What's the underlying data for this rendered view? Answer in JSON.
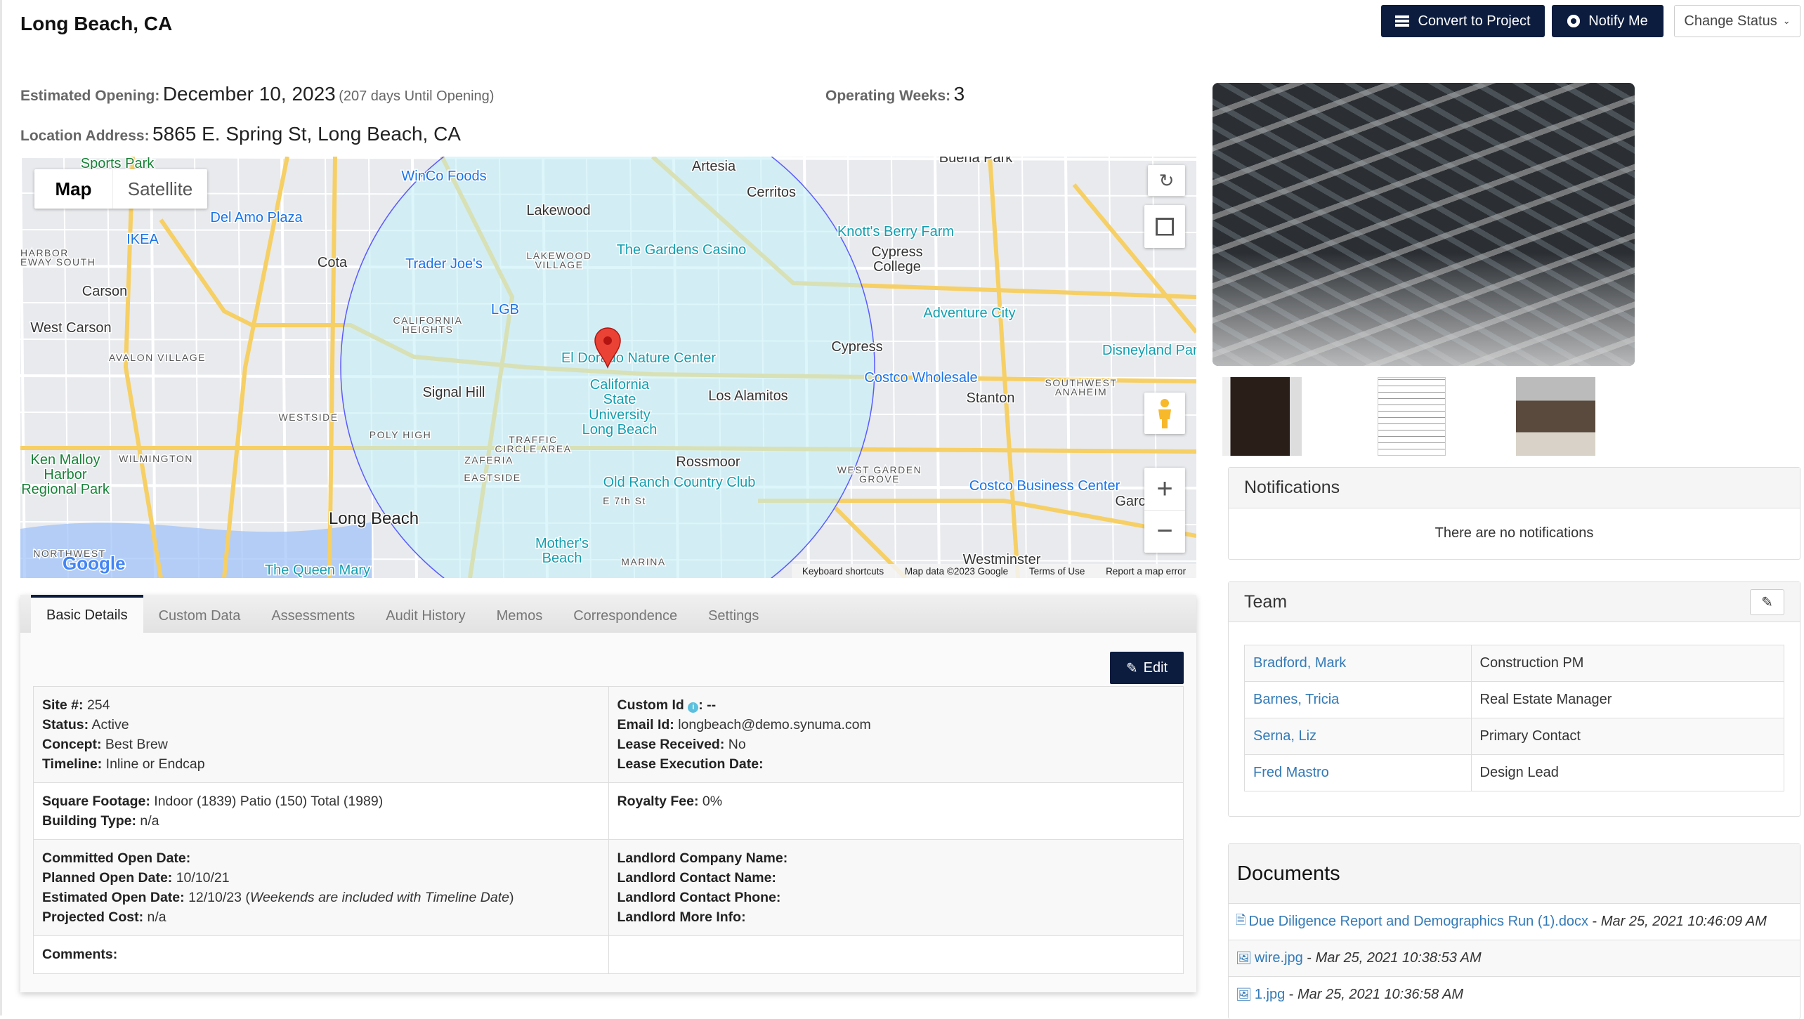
{
  "header": {
    "title": "Long Beach, CA",
    "convert_label": "Convert to Project",
    "notify_label": "Notify Me",
    "change_status_label": "Change Status"
  },
  "summary": {
    "estimated_opening_label": "Estimated Opening:",
    "estimated_opening_value": "December 10, 2023",
    "days_until": "(207 days Until Opening)",
    "operating_weeks_label": "Operating Weeks:",
    "operating_weeks_value": "3",
    "address_label": "Location Address:",
    "address_value": "5865 E. Spring St, Long Beach, CA"
  },
  "map": {
    "type_map": "Map",
    "type_satellite": "Satellite",
    "footer": {
      "shortcuts": "Keyboard shortcuts",
      "data": "Map data ©2023 Google",
      "terms": "Terms of Use",
      "report": "Report a map error"
    },
    "logo": "Google",
    "circle_color": "#5a5aff",
    "pin_color": "#ea4335",
    "labels": {
      "sports_park": "Sports Park",
      "winco": "WinCo Foods",
      "lakewood": "Lakewood",
      "cerritos": "Cerritos",
      "artesia": "Artesia",
      "buena_park": "Buena Park",
      "del_amo": "Del Amo Plaza",
      "ikea": "IKEA",
      "cota": "Cota",
      "trader_joes": "Trader Joe's",
      "gardens_casino": "The Gardens Casino",
      "knotts": "Knott's Berry Farm",
      "cypress_college_1": "Cypress",
      "cypress_college_2": "College",
      "carson": "Carson",
      "lgb": "LGB",
      "adventure_city": "Adventure City",
      "west_carson": "West Carson",
      "cypress": "Cypress",
      "disneyland": "Disneyland Par",
      "el_dorado": "El Dorado Nature Center",
      "costco_wholesale": "Costco Wholesale",
      "signal_hill": "Signal Hill",
      "csulb_1": "California",
      "csulb_2": "State",
      "csulb_3": "University",
      "csulb_4": "Long Beach",
      "los_alamitos": "Los Alamitos",
      "stanton": "Stanton",
      "rossmoor": "Rossmoor",
      "old_ranch": "Old Ranch Country Club",
      "costco_business": "Costco Business Center",
      "ken_malloy_1": "Ken Malloy",
      "ken_malloy_2": "Harbor",
      "ken_malloy_3": "Regional Park",
      "long_beach": "Long Beach",
      "mothers_beach_1": "Mother's",
      "mothers_beach_2": "Beach",
      "westminster": "Westminster",
      "queen_mary": "The Queen Mary",
      "garden_grove": "Garc",
      "e7th": "E 7th St",
      "harbor_1": "HARBOR",
      "harbor_2": "EWAY SOUTH",
      "avalon": "AVALON VILLAGE",
      "cal_heights_1": "CALIFORNIA",
      "cal_heights_2": "HEIGHTS",
      "lakewood_village_1": "LAKEWOOD",
      "lakewood_village_2": "VILLAGE",
      "westside": "WESTSIDE",
      "poly_high": "POLY HIGH",
      "wilmington": "WILMINGTON",
      "traffic_1": "TRAFFIC",
      "traffic_2": "CIRCLE AREA",
      "zaferia": "ZAFERIA",
      "eastside": "EASTSIDE",
      "wgg_1": "WEST GARDEN",
      "wgg_2": "GROVE",
      "sw_anaheim_1": "SOUTHWEST",
      "sw_anaheim_2": "ANAHEIM",
      "nw_san_pedro": "NORTHWEST",
      "marina": "MARINA"
    }
  },
  "tabs": [
    {
      "label": "Basic Details"
    },
    {
      "label": "Custom Data"
    },
    {
      "label": "Assessments"
    },
    {
      "label": "Audit History"
    },
    {
      "label": "Memos"
    },
    {
      "label": "Correspondence"
    },
    {
      "label": "Settings"
    }
  ],
  "details": {
    "edit_label": "Edit",
    "site_label": "Site #:",
    "site_value": "254",
    "status_label": "Status:",
    "status_value": "Active",
    "concept_label": "Concept:",
    "concept_value": "Best Brew",
    "timeline_label": "Timeline:",
    "timeline_value": "Inline or Endcap",
    "custom_id_label": "Custom Id",
    "custom_id_value": ": --",
    "email_label": "Email Id:",
    "email_value": "longbeach@demo.synuma.com",
    "lease_received_label": "Lease Received:",
    "lease_received_value": "No",
    "lease_exec_label": "Lease Execution Date:",
    "sqft_label": "Square Footage:",
    "sqft_value": "Indoor (1839) Patio (150) Total (1989)",
    "building_label": "Building Type:",
    "building_value": "n/a",
    "royalty_label": "Royalty Fee:",
    "royalty_value": "0%",
    "committed_label": "Committed Open Date:",
    "planned_label": "Planned Open Date:",
    "planned_value": "10/10/21",
    "est_open_label": "Estimated Open Date:",
    "est_open_value": "12/10/23 (",
    "est_open_note": "Weekends are included with Timeline Date",
    "est_open_close": ")",
    "projected_label": "Projected Cost:",
    "projected_value": "n/a",
    "landlord_company_label": "Landlord Company Name:",
    "landlord_contact_label": "Landlord Contact Name:",
    "landlord_phone_label": "Landlord Contact Phone:",
    "landlord_more_label": "Landlord More Info:",
    "comments_label": "Comments:"
  },
  "notifications": {
    "title": "Notifications",
    "empty": "There are no notifications"
  },
  "team": {
    "title": "Team",
    "members": [
      {
        "name": "Bradford, Mark",
        "role": "Construction PM"
      },
      {
        "name": "Barnes, Tricia",
        "role": "Real Estate Manager"
      },
      {
        "name": "Serna, Liz",
        "role": "Primary Contact"
      },
      {
        "name": "Fred Mastro",
        "role": "Design Lead"
      }
    ]
  },
  "documents": {
    "title": "Documents",
    "items": [
      {
        "name": "Due Diligence Report and Demographics Run (1).docx",
        "date": "Mar 25, 2021 10:46:09 AM",
        "icon": "word-file-icon"
      },
      {
        "name": "wire.jpg",
        "date": "Mar 25, 2021 10:38:53 AM",
        "icon": "image-file-icon"
      },
      {
        "name": "1.jpg",
        "date": "Mar 25, 2021 10:36:58 AM",
        "icon": "image-file-icon"
      }
    ]
  },
  "colors": {
    "primary": "#0b1c3f",
    "link": "#337ab7"
  }
}
